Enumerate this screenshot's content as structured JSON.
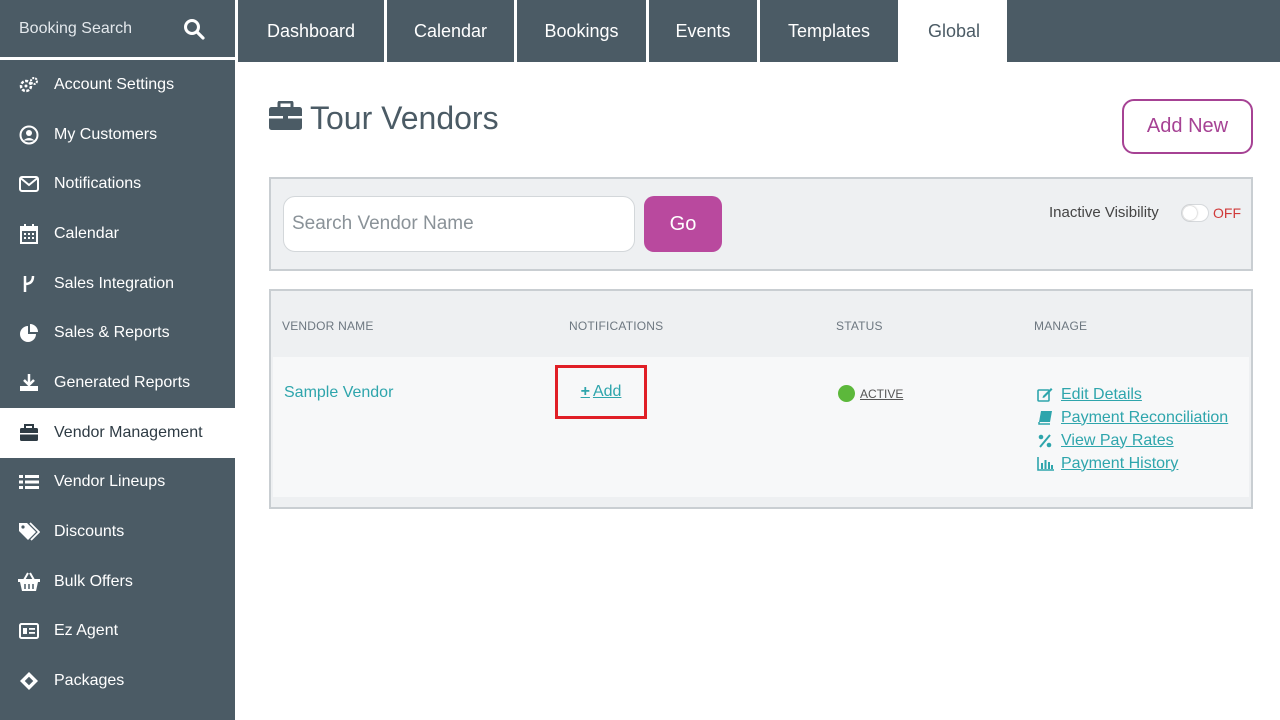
{
  "sidebar": {
    "search_label": "Booking Search",
    "items": [
      {
        "label": "Account Settings",
        "icon": "gears-icon"
      },
      {
        "label": "My Customers",
        "icon": "user-circle-icon"
      },
      {
        "label": "Notifications",
        "icon": "envelope-icon"
      },
      {
        "label": "Calendar",
        "icon": "calendar-icon"
      },
      {
        "label": "Sales Integration",
        "icon": "fork-icon"
      },
      {
        "label": "Sales & Reports",
        "icon": "pie-chart-icon"
      },
      {
        "label": "Generated Reports",
        "icon": "download-icon"
      },
      {
        "label": "Vendor Management",
        "icon": "briefcase-icon",
        "active": true
      },
      {
        "label": "Vendor Lineups",
        "icon": "list-icon"
      },
      {
        "label": "Discounts",
        "icon": "tags-icon"
      },
      {
        "label": "Bulk Offers",
        "icon": "basket-icon"
      },
      {
        "label": "Ez Agent",
        "icon": "id-card-icon"
      },
      {
        "label": "Packages",
        "icon": "ticket-icon"
      }
    ]
  },
  "topnav": {
    "tabs": [
      {
        "label": "Dashboard"
      },
      {
        "label": "Calendar"
      },
      {
        "label": "Bookings"
      },
      {
        "label": "Events"
      },
      {
        "label": "Templates"
      },
      {
        "label": "Global",
        "active": true
      }
    ]
  },
  "page": {
    "title": "Tour Vendors",
    "add_new_label": "Add New"
  },
  "search": {
    "placeholder": "Search Vendor Name",
    "value": "",
    "go_label": "Go",
    "inactive_label": "Inactive Visibility",
    "toggle_state": "OFF"
  },
  "table": {
    "headers": {
      "vendor_name": "VENDOR NAME",
      "notifications": "NOTIFICATIONS",
      "status": "STATUS",
      "manage": "MANAGE"
    },
    "rows": [
      {
        "vendor_name": "Sample Vendor",
        "notification_action": "Add",
        "status": "ACTIVE",
        "manage": [
          {
            "label": "Edit Details",
            "icon": "edit-icon"
          },
          {
            "label": "Payment Reconciliation",
            "icon": "book-icon"
          },
          {
            "label": "View Pay Rates",
            "icon": "percent-icon"
          },
          {
            "label": "Payment History",
            "icon": "bar-chart-icon"
          }
        ]
      }
    ]
  },
  "colors": {
    "sidebar_bg": "#4b5b65",
    "accent_magenta": "#b9499e",
    "link_teal": "#2ea5ac",
    "status_green": "#5cb83b",
    "highlight_red": "#e01f26"
  }
}
